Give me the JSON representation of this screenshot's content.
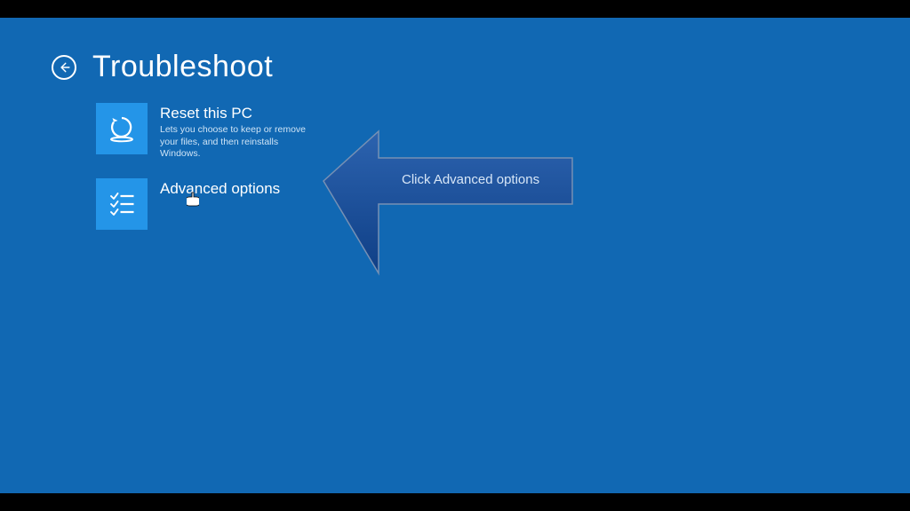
{
  "header": {
    "title": "Troubleshoot"
  },
  "options": [
    {
      "title": "Reset this PC",
      "description": "Lets you choose to keep or remove your files, and then reinstalls Windows."
    },
    {
      "title": "Advanced options",
      "description": ""
    }
  ],
  "callout": {
    "text": "Click Advanced options"
  },
  "colors": {
    "background": "#1168b3",
    "tile": "#2495e8",
    "arrow_fill": "#194f9b",
    "arrow_stroke": "#6f87a8"
  }
}
